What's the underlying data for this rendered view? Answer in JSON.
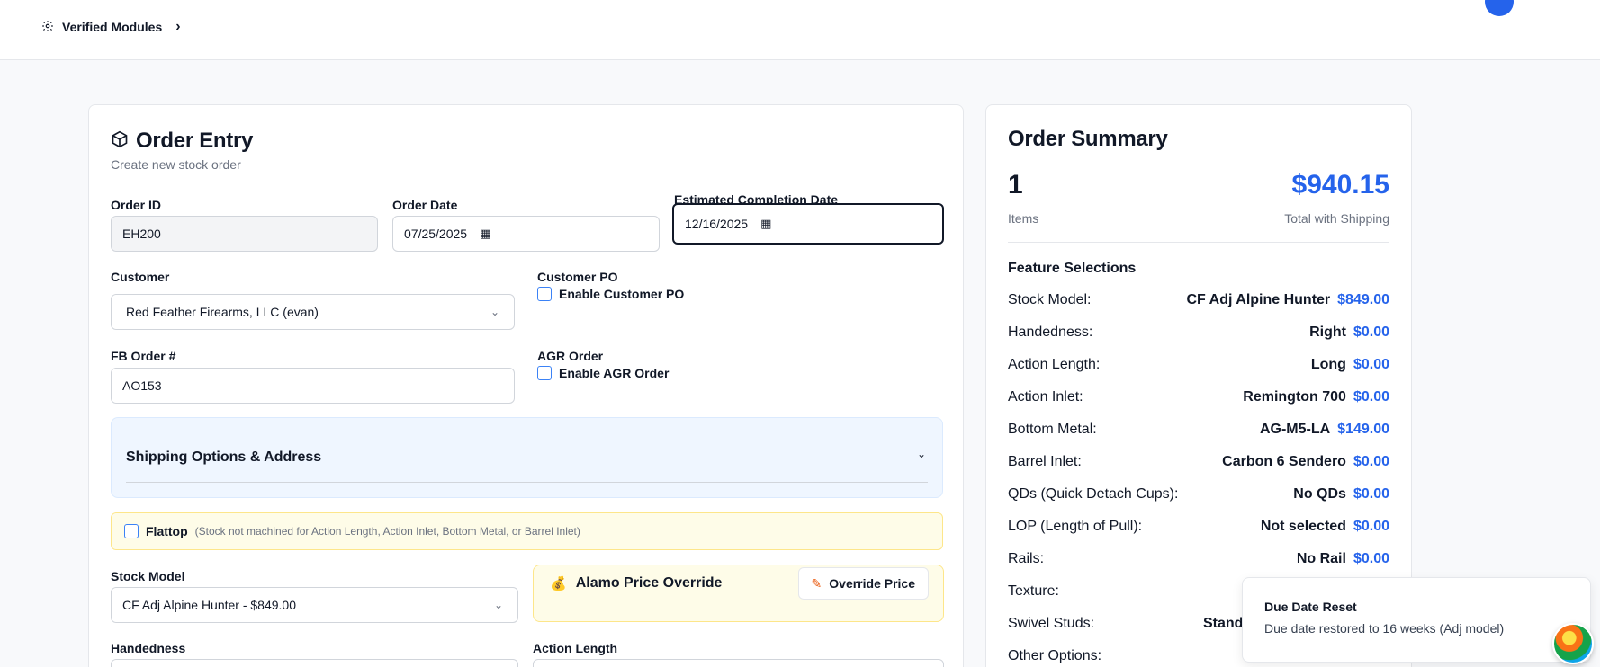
{
  "topbar": {
    "breadcrumb": "Verified Modules"
  },
  "entry": {
    "title": "Order Entry",
    "subtitle": "Create new stock order",
    "order_id_label": "Order ID",
    "order_id": "EH200",
    "order_date_label": "Order Date",
    "order_date": "07/25/2025",
    "est_label": "Estimated Completion Date",
    "est_date": "12/16/2025",
    "customer_label": "Customer",
    "customer": "Red Feather Firearms, LLC (evan)",
    "customer_po_label": "Customer PO",
    "customer_po_check": "Enable Customer PO",
    "fb_label": "FB Order #",
    "fb_order": "AO153",
    "agr_label": "AGR Order",
    "agr_check": "Enable AGR Order",
    "shipping_title": "Shipping Options & Address",
    "flattop_label": "Flattop",
    "flattop_note": "(Stock not machined for Action Length, Action Inlet, Bottom Metal, or Barrel Inlet)",
    "stock_model_label": "Stock Model",
    "stock_model": "CF Adj Alpine Hunter - $849.00",
    "alamo_title": "Alamo Price Override",
    "override_button": "Override Price",
    "handedness_label": "Handedness",
    "action_length_label": "Action Length"
  },
  "summary": {
    "title": "Order Summary",
    "items_count": "1",
    "items_label": "Items",
    "total": "$940.15",
    "total_label": "Total with Shipping",
    "features_title": "Feature Selections",
    "rows": [
      {
        "k": "Stock Model:",
        "v": "CF Adj Alpine Hunter",
        "p": "$849.00"
      },
      {
        "k": "Handedness:",
        "v": "Right",
        "p": "$0.00"
      },
      {
        "k": "Action Length:",
        "v": "Long",
        "p": "$0.00"
      },
      {
        "k": "Action Inlet:",
        "v": "Remington 700",
        "p": "$0.00"
      },
      {
        "k": "Bottom Metal:",
        "v": "AG-M5-LA",
        "p": "$149.00"
      },
      {
        "k": "Barrel Inlet:",
        "v": "Carbon 6 Sendero",
        "p": "$0.00"
      },
      {
        "k": "QDs (Quick Detach Cups):",
        "v": "No QDs",
        "p": "$0.00"
      },
      {
        "k": "LOP (Length of Pull):",
        "v": "Not selected",
        "p": "$0.00"
      },
      {
        "k": "Rails:",
        "v": "No Rail",
        "p": "$0.00"
      },
      {
        "k": "Texture:",
        "v": "",
        "p": ""
      },
      {
        "k": "Swivel Studs:",
        "v": "Standa",
        "p": ""
      },
      {
        "k": "Other Options:",
        "v": "",
        "p": ""
      }
    ]
  },
  "toast": {
    "title": "Due Date Reset",
    "message": "Due date restored to 16 weeks (Adj model)"
  },
  "colors": {
    "accent": "#2563eb",
    "shipping_bg": "#eff6ff",
    "flattop_bg": "#fefce8"
  }
}
